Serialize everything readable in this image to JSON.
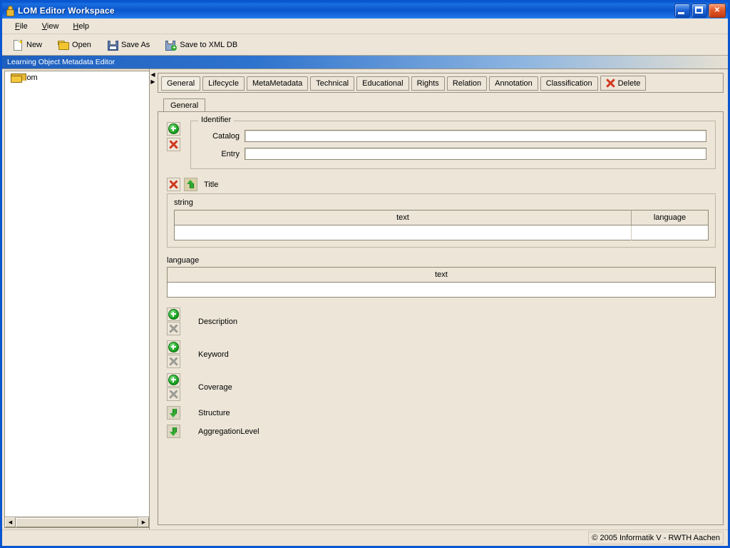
{
  "window": {
    "title": "LOM Editor Workspace",
    "title_icon": "person-icon",
    "buttons": {
      "minimize": "minimize-button",
      "maximize": "maximize-button",
      "close": "close-button"
    }
  },
  "menu": {
    "items": [
      {
        "label": "File",
        "mnemonic": "F"
      },
      {
        "label": "View",
        "mnemonic": "V"
      },
      {
        "label": "Help",
        "mnemonic": "H"
      }
    ]
  },
  "toolbar": {
    "items": [
      {
        "label": "New",
        "icon": "new-document-icon"
      },
      {
        "label": "Open",
        "icon": "open-folder-icon"
      },
      {
        "label": "Save As",
        "icon": "floppy-disk-icon"
      },
      {
        "label": "Save to XML DB",
        "icon": "database-save-icon"
      }
    ]
  },
  "banner": {
    "text": "Learning Object Metadata Editor"
  },
  "tree": {
    "items": [
      {
        "label": "lom",
        "icon": "folder-icon"
      }
    ],
    "scrollbar": {
      "left_arrow": "◀",
      "right_arrow": "▶"
    }
  },
  "divider": {
    "collapse_left": "◀",
    "collapse_right": "▶"
  },
  "tabs": {
    "items": [
      {
        "label": "General",
        "selected": true
      },
      {
        "label": "Lifecycle",
        "selected": false
      },
      {
        "label": "MetaMetadata",
        "selected": false
      },
      {
        "label": "Technical",
        "selected": false
      },
      {
        "label": "Educational",
        "selected": false
      },
      {
        "label": "Rights",
        "selected": false
      },
      {
        "label": "Relation",
        "selected": false
      },
      {
        "label": "Annotation",
        "selected": false
      },
      {
        "label": "Classification",
        "selected": false
      }
    ],
    "delete": {
      "label": "Delete",
      "icon": "delete-x-icon"
    }
  },
  "subtab": {
    "label": "General"
  },
  "identifier": {
    "legend": "Identifier",
    "add_icon": "add-green-plus-icon",
    "remove_icon": "remove-red-x-icon",
    "fields": [
      {
        "label": "Catalog",
        "value": "",
        "placeholder": ""
      },
      {
        "label": "Entry",
        "value": "",
        "placeholder": ""
      }
    ]
  },
  "title_section": {
    "label": "Title",
    "remove_icon": "remove-red-x-icon",
    "up_icon": "move-up-green-arrow-icon",
    "string_group": {
      "label": "string",
      "columns": [
        "text",
        "language"
      ],
      "rows": [
        [
          "",
          ""
        ]
      ]
    }
  },
  "language_section": {
    "label": "language",
    "columns": [
      "text"
    ],
    "rows": [
      [
        ""
      ]
    ]
  },
  "actions": [
    {
      "label": "Description",
      "add_icon": "add-green-plus-icon",
      "remove_icon": "remove-grey-x-icon",
      "type": "addremove"
    },
    {
      "label": "Keyword",
      "add_icon": "add-green-plus-icon",
      "remove_icon": "remove-grey-x-icon",
      "type": "addremove"
    },
    {
      "label": "Coverage",
      "add_icon": "add-green-plus-icon",
      "remove_icon": "remove-grey-x-icon",
      "type": "addremove"
    },
    {
      "label": "Structure",
      "add_icon": "expand-down-green-arrow-icon",
      "type": "expand"
    },
    {
      "label": "AggregationLevel",
      "add_icon": "expand-down-green-arrow-icon",
      "type": "expand"
    }
  ],
  "statusbar": {
    "copyright": "© 2005 Informatik V - RWTH Aachen"
  },
  "colors": {
    "window_frame": "#0A55D0",
    "titlebar_blue": "#0A55CC",
    "background": "#ECE5D8",
    "banner_blue": "#1E5FBE",
    "accent_green": "#0F9A17",
    "accent_red": "#CF3A1E",
    "border": "#9A9382"
  }
}
